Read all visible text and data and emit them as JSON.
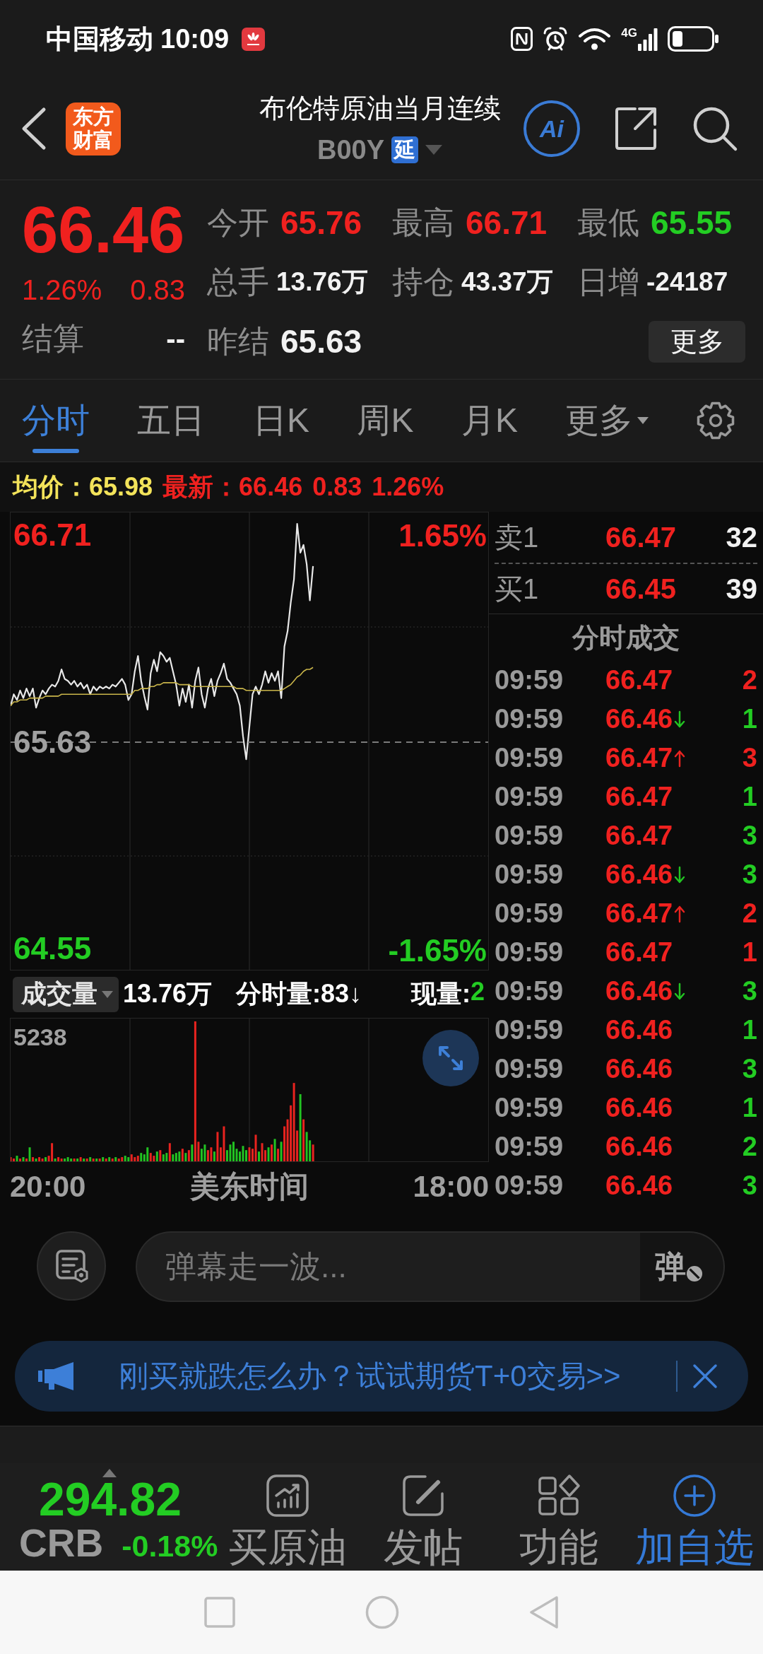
{
  "status_bar": {
    "carrier": "中国移动",
    "time": "10:09",
    "network": "4G"
  },
  "header": {
    "logo": "东方财富",
    "title": "布伦特原油当月连续",
    "code": "B00Y",
    "badge": "延",
    "ai": "Ai"
  },
  "quote": {
    "price": "66.46",
    "rising": true,
    "change_pct": "1.26%",
    "change": "0.83",
    "settle_label": "结算",
    "settle_value": "--",
    "stats": [
      {
        "label": "今开",
        "value": "65.76",
        "color": "#f0211f"
      },
      {
        "label": "最高",
        "value": "66.71",
        "color": "#f0211f"
      },
      {
        "label": "最低",
        "value": "65.55",
        "color": "#23cd23"
      },
      {
        "label": "总手",
        "value": "13.76万",
        "color": "#f2f2f2"
      },
      {
        "label": "持仓",
        "value": "43.37万",
        "color": "#f2f2f2"
      },
      {
        "label": "日增",
        "value": "-24187",
        "color": "#f2f2f2"
      },
      {
        "label": "昨结",
        "value": "65.63",
        "color": "#f2f2f2"
      }
    ],
    "more": "更多"
  },
  "period_tabs": [
    {
      "label": "分时",
      "selected": true,
      "dropdown": false
    },
    {
      "label": "五日",
      "selected": false,
      "dropdown": false
    },
    {
      "label": "日K",
      "selected": false,
      "dropdown": false
    },
    {
      "label": "周K",
      "selected": false,
      "dropdown": false
    },
    {
      "label": "月K",
      "selected": false,
      "dropdown": false
    },
    {
      "label": "更多",
      "selected": false,
      "dropdown": true
    }
  ],
  "summary": {
    "average_label": "均价：",
    "average": "65.98",
    "latest_label": "最新：",
    "latest": "66.46",
    "change": "0.83",
    "change_pct": "1.26%"
  },
  "chart": {
    "chart_data": {
      "type": "line",
      "ylim": [
        64.44,
        66.83
      ],
      "yticks": [
        {
          "value": 66.71,
          "label": "66.71"
        },
        {
          "value": 65.63,
          "label": "65.63"
        },
        {
          "value": 64.55,
          "label": "64.55"
        }
      ],
      "series": [
        {
          "color": "#e8e8e8",
          "values": [
            65.82,
            65.88,
            65.85,
            65.9,
            65.86,
            65.91,
            65.87,
            65.91,
            65.81,
            65.86,
            65.9,
            65.88,
            65.91,
            65.93,
            65.92,
            65.95,
            66.01,
            65.96,
            65.95,
            65.93,
            65.95,
            65.92,
            65.94,
            65.91,
            65.93,
            65.88,
            65.92,
            65.9,
            65.92,
            65.91,
            65.92,
            65.91,
            65.93,
            65.92,
            65.94,
            65.96,
            65.93,
            65.85,
            65.88,
            66.0,
            66.08,
            65.95,
            65.87,
            65.8,
            65.99,
            66.06,
            66.0,
            66.1,
            66.08,
            66.05,
            66.07,
            66.0,
            65.93,
            65.82,
            65.91,
            65.84,
            65.93,
            65.81,
            65.95,
            66.02,
            65.88,
            65.81,
            65.91,
            65.96,
            65.87,
            65.95,
            65.99,
            66.04,
            65.96,
            65.94,
            65.91,
            65.88,
            65.82,
            65.66,
            65.54,
            65.71,
            65.88,
            65.92,
            65.88,
            65.93,
            66.0,
            65.94,
            65.99,
            65.95,
            66.0,
            65.86,
            66.13,
            66.21,
            66.36,
            66.48,
            66.77,
            66.62,
            66.66,
            66.56,
            66.37,
            66.55,
            null,
            null,
            null,
            null,
            null,
            null,
            null,
            null,
            null,
            null,
            null,
            null,
            null,
            null,
            null,
            null,
            null,
            null,
            null,
            null,
            null,
            null,
            null,
            null,
            null,
            null,
            null,
            null,
            null,
            null,
            null,
            null,
            null,
            null,
            null,
            null,
            null,
            null,
            null,
            null,
            null,
            null,
            null,
            null,
            null,
            null,
            null,
            null,
            null,
            null,
            null,
            null,
            null,
            null,
            null
          ]
        },
        {
          "color": "#c9b54a",
          "values": [
            65.82,
            65.84,
            65.84,
            65.85,
            65.85,
            65.85,
            65.86,
            65.86,
            65.86,
            65.86,
            65.86,
            65.87,
            65.87,
            65.87,
            65.87,
            65.87,
            65.88,
            65.88,
            65.88,
            65.88,
            65.88,
            65.88,
            65.88,
            65.88,
            65.88,
            65.88,
            65.88,
            65.88,
            65.88,
            65.88,
            65.88,
            65.88,
            65.88,
            65.88,
            65.88,
            65.88,
            65.88,
            65.88,
            65.88,
            65.9,
            65.9,
            65.91,
            65.91,
            65.91,
            65.92,
            65.92,
            65.93,
            65.93,
            65.94,
            65.94,
            65.94,
            65.94,
            65.94,
            65.93,
            65.93,
            65.93,
            65.93,
            65.92,
            65.92,
            65.92,
            65.92,
            65.92,
            65.92,
            65.92,
            65.92,
            65.92,
            65.92,
            65.92,
            65.92,
            65.92,
            65.92,
            65.91,
            65.91,
            65.91,
            65.9,
            65.9,
            65.9,
            65.9,
            65.9,
            65.9,
            65.9,
            65.9,
            65.9,
            65.9,
            65.9,
            65.9,
            65.91,
            65.92,
            65.93,
            65.95,
            65.97,
            65.98,
            66.0,
            66.01,
            66.01,
            66.02,
            null,
            null,
            null,
            null,
            null,
            null,
            null,
            null,
            null,
            null,
            null,
            null,
            null,
            null,
            null,
            null,
            null,
            null,
            null,
            null,
            null,
            null,
            null,
            null,
            null,
            null,
            null,
            null,
            null,
            null,
            null,
            null,
            null,
            null,
            null,
            null,
            null,
            null,
            null,
            null,
            null,
            null,
            null,
            null,
            null,
            null,
            null,
            null,
            null,
            null,
            null,
            null,
            null,
            null,
            null
          ]
        },
        {
          "color": "#7a7a7a",
          "line_style": "dashed",
          "values": [
            65.63,
            65.63,
            65.63,
            65.63,
            65.63,
            65.63,
            65.63,
            65.63,
            65.63,
            65.63,
            65.63,
            65.63,
            65.63,
            65.63,
            65.63,
            65.63,
            65.63,
            65.63,
            65.63,
            65.63,
            65.63,
            65.63,
            65.63,
            65.63,
            65.63,
            65.63,
            65.63,
            65.63,
            65.63,
            65.63,
            65.63,
            65.63,
            65.63,
            65.63,
            65.63,
            65.63,
            65.63,
            65.63,
            65.63,
            65.63,
            65.63,
            65.63,
            65.63,
            65.63,
            65.63,
            65.63,
            65.63,
            65.63,
            65.63,
            65.63,
            65.63,
            65.63,
            65.63,
            65.63,
            65.63,
            65.63,
            65.63,
            65.63,
            65.63,
            65.63,
            65.63,
            65.63,
            65.63,
            65.63,
            65.63,
            65.63,
            65.63,
            65.63,
            65.63,
            65.63,
            65.63,
            65.63,
            65.63,
            65.63,
            65.63,
            65.63,
            65.63,
            65.63,
            65.63,
            65.63,
            65.63,
            65.63,
            65.63,
            65.63,
            65.63,
            65.63,
            65.63,
            65.63,
            65.63,
            65.63,
            65.63,
            65.63,
            65.63,
            65.63,
            65.63,
            65.63,
            65.63,
            65.63,
            65.63,
            65.63,
            65.63,
            65.63,
            65.63,
            65.63,
            65.63,
            65.63,
            65.63,
            65.63,
            65.63,
            65.63,
            65.63,
            65.63,
            65.63,
            65.63,
            65.63,
            65.63,
            65.63,
            65.63,
            65.63,
            65.63,
            65.63,
            65.63,
            65.63,
            65.63,
            65.63,
            65.63,
            65.63,
            65.63,
            65.63,
            65.63,
            65.63,
            65.63,
            65.63,
            65.63,
            65.63,
            65.63,
            65.63,
            65.63,
            65.63,
            65.63,
            65.63,
            65.63,
            65.63,
            65.63,
            65.63,
            65.63,
            65.63,
            65.63,
            65.63,
            65.63,
            65.63
          ]
        }
      ]
    },
    "percent_labels": [
      {
        "text": "1.65%",
        "color": "#f0211f"
      },
      {
        "text": "-1.65%",
        "color": "#23cd23"
      }
    ]
  },
  "volume": {
    "selector": "成交量",
    "total": "13.76万",
    "interval": "分时量:83↓",
    "current_label": "现量:",
    "current": "2",
    "current_rising": false,
    "max": "5238"
  },
  "time_axis": {
    "start": "20:00",
    "zone": "美东时间",
    "end": "18:00"
  },
  "order_book": [
    {
      "label": "卖1",
      "price": "66.47",
      "volume": "32"
    },
    {
      "label": "买1",
      "price": "66.45",
      "volume": "39"
    }
  ],
  "trades_title": "分时成交",
  "trades": [
    {
      "time": "09:59",
      "price": "66.47",
      "kind": "plain",
      "volume": "2",
      "color": "#f0211f"
    },
    {
      "time": "09:59",
      "price": "66.46",
      "kind": "down",
      "volume": "1",
      "color": "#23cd23"
    },
    {
      "time": "09:59",
      "price": "66.47",
      "kind": "up",
      "volume": "3",
      "color": "#f0211f"
    },
    {
      "time": "09:59",
      "price": "66.47",
      "kind": "plain",
      "volume": "1",
      "color": "#23cd23"
    },
    {
      "time": "09:59",
      "price": "66.47",
      "kind": "plain",
      "volume": "3",
      "color": "#23cd23"
    },
    {
      "time": "09:59",
      "price": "66.46",
      "kind": "down",
      "volume": "3",
      "color": "#23cd23"
    },
    {
      "time": "09:59",
      "price": "66.47",
      "kind": "up",
      "volume": "2",
      "color": "#f0211f"
    },
    {
      "time": "09:59",
      "price": "66.47",
      "kind": "plain",
      "volume": "1",
      "color": "#f0211f"
    },
    {
      "time": "09:59",
      "price": "66.46",
      "kind": "down",
      "volume": "3",
      "color": "#23cd23"
    },
    {
      "time": "09:59",
      "price": "66.46",
      "kind": "plain",
      "volume": "1",
      "color": "#23cd23"
    },
    {
      "time": "09:59",
      "price": "66.46",
      "kind": "plain",
      "volume": "3",
      "color": "#23cd23"
    },
    {
      "time": "09:59",
      "price": "66.46",
      "kind": "plain",
      "volume": "1",
      "color": "#23cd23"
    },
    {
      "time": "09:59",
      "price": "66.46",
      "kind": "plain",
      "volume": "2",
      "color": "#23cd23"
    },
    {
      "time": "09:59",
      "price": "66.46",
      "kind": "plain",
      "volume": "3",
      "color": "#23cd23"
    }
  ],
  "comment_bar": {
    "placeholder": "弹幕走一波...",
    "button": "弹"
  },
  "promo": {
    "text": "刚买就跌怎么办？试试期货T+0交易>>"
  },
  "bottom_bar": {
    "index": {
      "value": "294.82",
      "name": "CRB",
      "change": "-0.18%",
      "rising": false
    },
    "actions": [
      {
        "label": "买原油",
        "kind": "chart"
      },
      {
        "label": "发帖",
        "kind": "edit"
      },
      {
        "label": "功能",
        "kind": "grid"
      },
      {
        "label": "加自选",
        "kind": "add"
      }
    ]
  }
}
